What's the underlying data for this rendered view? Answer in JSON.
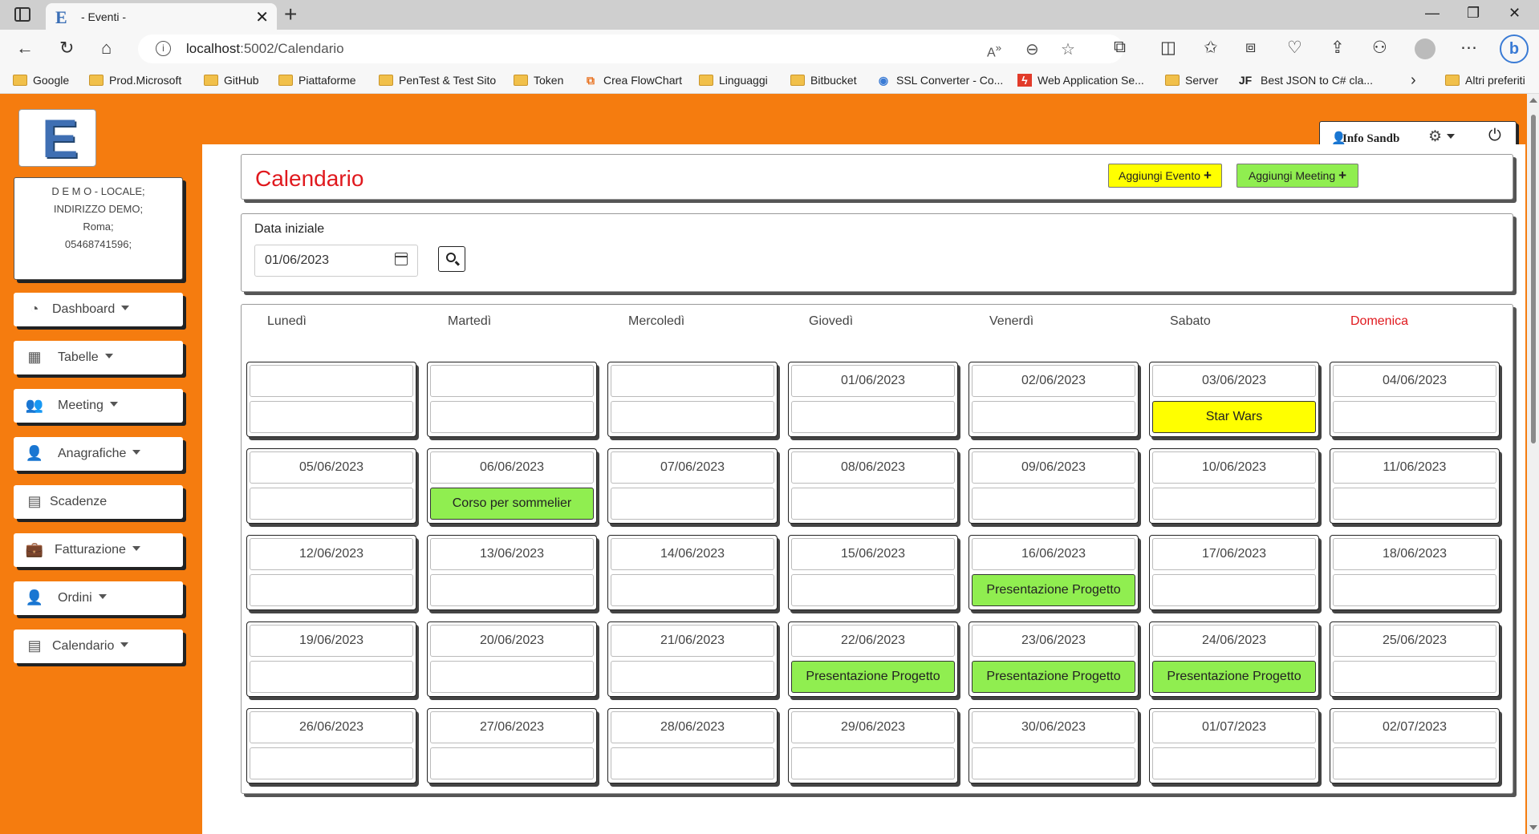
{
  "browser": {
    "tab_title": "- Eventi -",
    "tab_favicon": "E",
    "url_host": "localhost",
    "url_path": ":5002/Calendario",
    "bookmarks": [
      {
        "label": "Google",
        "icon": "folder-icon"
      },
      {
        "label": "Prod.Microsoft",
        "icon": "folder-icon"
      },
      {
        "label": "GitHub",
        "icon": "folder-icon"
      },
      {
        "label": "Piattaforme",
        "icon": "folder-icon"
      },
      {
        "label": "PenTest & Test Sito",
        "icon": "folder-icon"
      },
      {
        "label": "Token",
        "icon": "folder-icon"
      },
      {
        "label": "Crea FlowChart",
        "icon": "flowchart-icon"
      },
      {
        "label": "Linguaggi",
        "icon": "folder-icon"
      },
      {
        "label": "Bitbucket",
        "icon": "folder-icon"
      },
      {
        "label": "SSL Converter - Co...",
        "icon": "ssl-icon"
      },
      {
        "label": "Web Application Se...",
        "icon": "webapp-icon"
      },
      {
        "label": "Server",
        "icon": "folder-icon"
      },
      {
        "label": "Best JSON to C# cla...",
        "icon": "jf-icon"
      }
    ],
    "other_favorites": "Altri preferiti"
  },
  "app": {
    "logo_letter": "E",
    "user_name": "Info Sandb",
    "company": {
      "line1": "D E M O - LOCALE;",
      "line2": "INDIRIZZO DEMO;",
      "line3": "Roma;",
      "line4": "05468741596;"
    },
    "menu": [
      {
        "label": "Dashboard",
        "icon": "dashboard-icon",
        "dropdown": true
      },
      {
        "label": "Tabelle",
        "icon": "table-icon",
        "dropdown": true
      },
      {
        "label": "Meeting",
        "icon": "users-icon",
        "dropdown": true
      },
      {
        "label": "Anagrafiche",
        "icon": "user-gear-icon",
        "dropdown": true
      },
      {
        "label": "Scadenze",
        "icon": "calendar-icon",
        "dropdown": false
      },
      {
        "label": "Fatturazione",
        "icon": "briefcase-icon",
        "dropdown": true
      },
      {
        "label": "Ordini",
        "icon": "user-gear-icon",
        "dropdown": true
      },
      {
        "label": "Calendario",
        "icon": "calendar-icon",
        "dropdown": true
      }
    ],
    "title": "Calendario",
    "add_event": "Aggiungi Evento",
    "add_meeting": "Aggiungi Meeting",
    "start_date_label": "Data iniziale",
    "start_date_value": "01/06/2023",
    "weekdays": [
      "Lunedì",
      "Martedì",
      "Mercoledì",
      "Giovedì",
      "Venerdì",
      "Sabato",
      "Domenica"
    ],
    "colors": {
      "header": "#f57c0f",
      "title": "#e0191e",
      "event_yellow": "#ffff00",
      "event_green": "#90ee50"
    },
    "calendar": [
      [
        "",
        "",
        "",
        "01/06/2023",
        "02/06/2023",
        "03/06/2023",
        "04/06/2023"
      ],
      [
        "05/06/2023",
        "06/06/2023",
        "07/06/2023",
        "08/06/2023",
        "09/06/2023",
        "10/06/2023",
        "11/06/2023"
      ],
      [
        "12/06/2023",
        "13/06/2023",
        "14/06/2023",
        "15/06/2023",
        "16/06/2023",
        "17/06/2023",
        "18/06/2023"
      ],
      [
        "19/06/2023",
        "20/06/2023",
        "21/06/2023",
        "22/06/2023",
        "23/06/2023",
        "24/06/2023",
        "25/06/2023"
      ],
      [
        "26/06/2023",
        "27/06/2023",
        "28/06/2023",
        "29/06/2023",
        "30/06/2023",
        "01/07/2023",
        "02/07/2023"
      ]
    ],
    "events": [
      {
        "date": "03/06/2023",
        "title": "Star Wars",
        "color": "#ffff00"
      },
      {
        "date": "06/06/2023",
        "title": "Corso per sommelier",
        "color": "#90ee50"
      },
      {
        "date": "16/06/2023",
        "title": "Presentazione Progetto",
        "color": "#90ee50"
      },
      {
        "date": "22/06/2023",
        "title": "Presentazione Progetto",
        "color": "#90ee50"
      },
      {
        "date": "23/06/2023",
        "title": "Presentazione Progetto",
        "color": "#90ee50"
      },
      {
        "date": "24/06/2023",
        "title": "Presentazione Progetto",
        "color": "#90ee50"
      }
    ]
  }
}
